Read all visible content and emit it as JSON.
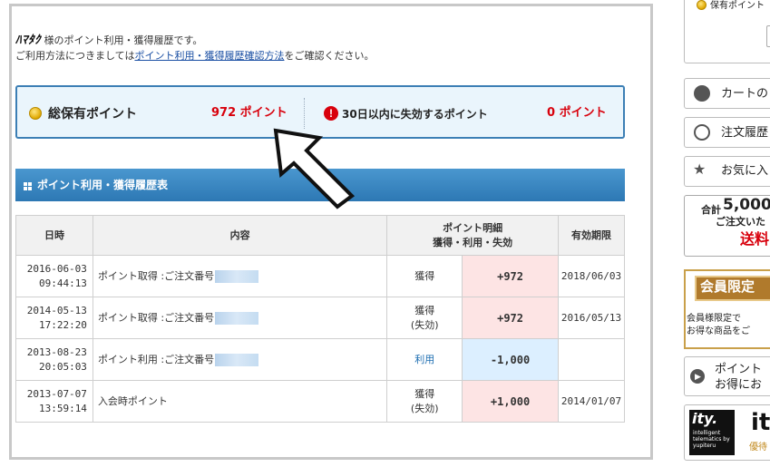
{
  "intro": {
    "user_name": "ﾊﾏﾀｸ",
    "line1_suffix": " 様のポイント利用・獲得履歴です。",
    "line2_prefix": "ご利用方法につきましては",
    "line2_link": "ポイント利用・獲得履歴確認方法",
    "line2_suffix": "をご確認ください。"
  },
  "summary": {
    "total_label": "総保有ポイント",
    "total_value": "972 ポイント",
    "expiring_label": "30日以内に失効するポイント",
    "expiring_value": "0 ポイント",
    "warn_glyph": "!"
  },
  "section": {
    "title": "ポイント利用・獲得履歴表"
  },
  "table": {
    "headers": {
      "date": "日時",
      "content": "内容",
      "detail_line1": "ポイント明細",
      "detail_line2": "獲得・利用・失効",
      "expiry": "有効期限"
    },
    "rows": [
      {
        "date": "2016-06-03",
        "time": "09:44:13",
        "content": "ポイント取得 :ご注文番号",
        "type1": "獲得",
        "type2": "",
        "points": "+972",
        "expiry": "2018/06/03"
      },
      {
        "date": "2014-05-13",
        "time": "17:22:20",
        "content": "ポイント取得 :ご注文番号",
        "type1": "獲得",
        "type2": "(失効)",
        "points": "+972",
        "expiry": "2016/05/13"
      },
      {
        "date": "2013-08-23",
        "time": "20:05:03",
        "content": "ポイント利用 :ご注文番号",
        "type1": "利用",
        "type2": "",
        "points": "-1,000",
        "expiry": ""
      },
      {
        "date": "2013-07-07",
        "time": "13:59:14",
        "content": "入会時ポイント",
        "type1": "獲得",
        "type2": "(失効)",
        "points": "+1,000",
        "expiry": "2014/01/07"
      }
    ]
  },
  "sidebar": {
    "points_label": "保有ポイント",
    "cart": "カートの",
    "history": "注文履歴",
    "favorites": "お気に入",
    "promo_line1_prefix": "合計",
    "promo_line1_num": "5,000",
    "promo_line2": "ご注文いた",
    "promo_line3": "送料",
    "member_title": "会員限定",
    "member_line1": "会員様限定で",
    "member_line2": "お得な商品をご",
    "points_info_line1": "ポイント",
    "points_info_line2": "お得にお",
    "ity_logo": "ity.",
    "ity_sub1": "intelligent",
    "ity_sub2": "telematics by",
    "ity_sub3": "yupiteru",
    "ity_big": "it",
    "ity_caption": "優待"
  }
}
